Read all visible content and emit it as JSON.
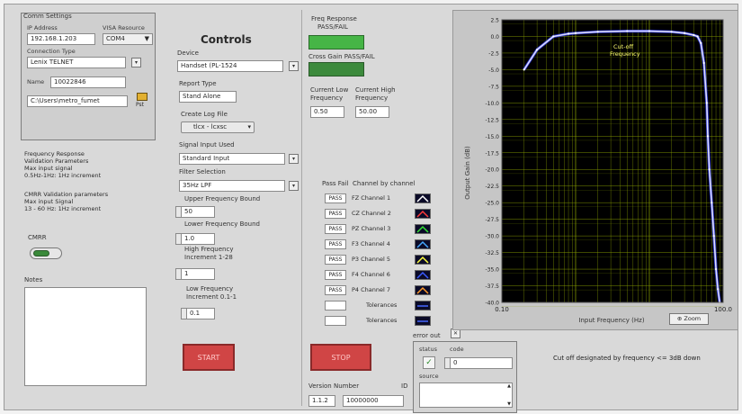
{
  "comm": {
    "title": "Comm Settings",
    "ip_label": "IP Address",
    "ip_value": "192.168.1.203",
    "visa_label": "VISA Resource",
    "visa_value": "COM4",
    "connection_label": "Connection Type",
    "connection_value": "Lenix TELNET",
    "name_label": "Name",
    "name_value": "10022846",
    "path_value": "C:\\Users\\metro_fumet",
    "browse_label": "Pst"
  },
  "info": {
    "freq_text": [
      "Frequency Response",
      "Validation Parameters",
      "Max input signal",
      "0.5Hz-1Hz: 1Hz increment"
    ],
    "cmrr_text": [
      "CMRR Validation parameters",
      "Max input Signal",
      "13 - 60 Hz: 1Hz increment"
    ],
    "cmrr_label": "CMRR",
    "notes_label": "Notes"
  },
  "controls": {
    "title": "Controls",
    "device_label": "Device",
    "device_value": "Handset (PL-1524",
    "report_label": "Report Type",
    "report_value": "Stand Alone",
    "logfile_label": "Create Log File",
    "logfile_value": "tlcx - lcxsc",
    "signal_label": "Signal Input Used",
    "signal_value": "Standard Input",
    "filter_label": "Filter Selection",
    "filter_value": "35Hz LPF",
    "upper_label": "Upper Frequency Bound",
    "upper_value": "50",
    "lower_label": "Lower Frequency Bound",
    "lower_value": "1.0",
    "high_inc_label": [
      "High Frequency",
      "Increment 1-28"
    ],
    "high_inc_value": "1",
    "low_inc_label": [
      "Low Frequency",
      "Increment 0.1-1"
    ],
    "low_inc_value": "0.1",
    "start_label": "START"
  },
  "freq": {
    "title": [
      "Freq Response",
      "PASS/FAIL"
    ],
    "crossgain_label": "Cross Gain PASS/FAIL",
    "cur_low_label": [
      "Current Low",
      "Frequency"
    ],
    "cur_high_label": [
      "Current High",
      "Frequency"
    ],
    "cur_low_value": "0.50",
    "cur_high_value": "50.00",
    "pass_header": "Pass Fail",
    "channel_header": "Channel by channel",
    "pass_values": [
      "PASS",
      "PASS",
      "PASS",
      "PASS",
      "PASS",
      "PASS",
      "PASS",
      "",
      ""
    ],
    "channels": [
      {
        "name": "FZ Channel 1",
        "color": "#ffffff"
      },
      {
        "name": "CZ Channel 2",
        "color": "#ff3a3a"
      },
      {
        "name": "PZ Channel 3",
        "color": "#35e035"
      },
      {
        "name": "F3 Channel 4",
        "color": "#47a8ff"
      },
      {
        "name": "P3 Channel 5",
        "color": "#ffff40"
      },
      {
        "name": "F4 Channel 6",
        "color": "#3a5bff"
      },
      {
        "name": "P4 Channel 7",
        "color": "#ff9a2a"
      },
      {
        "name": "Tolerances",
        "color": "#4466ff"
      },
      {
        "name": "Tolerances",
        "color": "#4466ff"
      }
    ],
    "stop_label": "STOP",
    "version_label": "Version Number",
    "version_value": "1.1.2",
    "id_label": "ID",
    "id_value": "10000000"
  },
  "error": {
    "title": "error out",
    "status_label": "status",
    "code_label": "code",
    "code_value": "0",
    "source_label": "source",
    "check_icon": "✓"
  },
  "chart": {
    "ylabel": "Output Gain (dB)",
    "xlabel": "Input Frequency (Hz)",
    "yticks": [
      "2.5",
      "0.0",
      "-2.5",
      "-5.0",
      "-7.5",
      "-10.0",
      "-12.5",
      "-15.0",
      "-17.5",
      "-20.0",
      "-22.5",
      "-25.0",
      "-27.5",
      "-30.0",
      "-32.5",
      "-35.0",
      "-37.5",
      "-40.0"
    ],
    "ytick_values": [
      2.5,
      0,
      -2.5,
      -5,
      -7.5,
      -10,
      -12.5,
      -15,
      -17.5,
      -20,
      -22.5,
      -25,
      -27.5,
      -30,
      -32.5,
      -35,
      -37.5,
      -40
    ],
    "yrange": [
      -40,
      2.5
    ],
    "xrange": [
      0.1,
      100
    ],
    "xticks": [
      "0.10",
      "100.0"
    ],
    "annotation": [
      "Cut-off",
      "Frequency"
    ],
    "zoom_label": "Zoom",
    "cutoff_text": "Cut off designated by frequency <= 3dB down"
  },
  "chart_data": {
    "type": "line",
    "x": [
      0.2,
      0.3,
      0.5,
      0.8,
      1.0,
      2.0,
      5.0,
      10.0,
      20.0,
      30.0,
      40.0,
      45.0,
      50.0,
      55.0,
      60.0,
      62.0,
      65.0,
      70.0,
      75.0,
      80.0,
      85.0,
      90.0
    ],
    "y": [
      -5.0,
      -2.0,
      0.0,
      0.4,
      0.5,
      0.7,
      0.8,
      0.8,
      0.7,
      0.5,
      0.2,
      0.0,
      -1.0,
      -4.0,
      -10.0,
      -15.0,
      -20.0,
      -25.0,
      -30.0,
      -35.0,
      -38.0,
      -40.0
    ],
    "ylabel": "Output Gain (dB)",
    "xlabel": "Input Frequency (Hz)",
    "xlim": [
      0.1,
      100
    ],
    "ylim": [
      -40,
      2.5
    ],
    "xscale": "log",
    "grid": true,
    "background": "#000000",
    "grid_color": "#8aa000",
    "line_color": "#dcdcff"
  }
}
